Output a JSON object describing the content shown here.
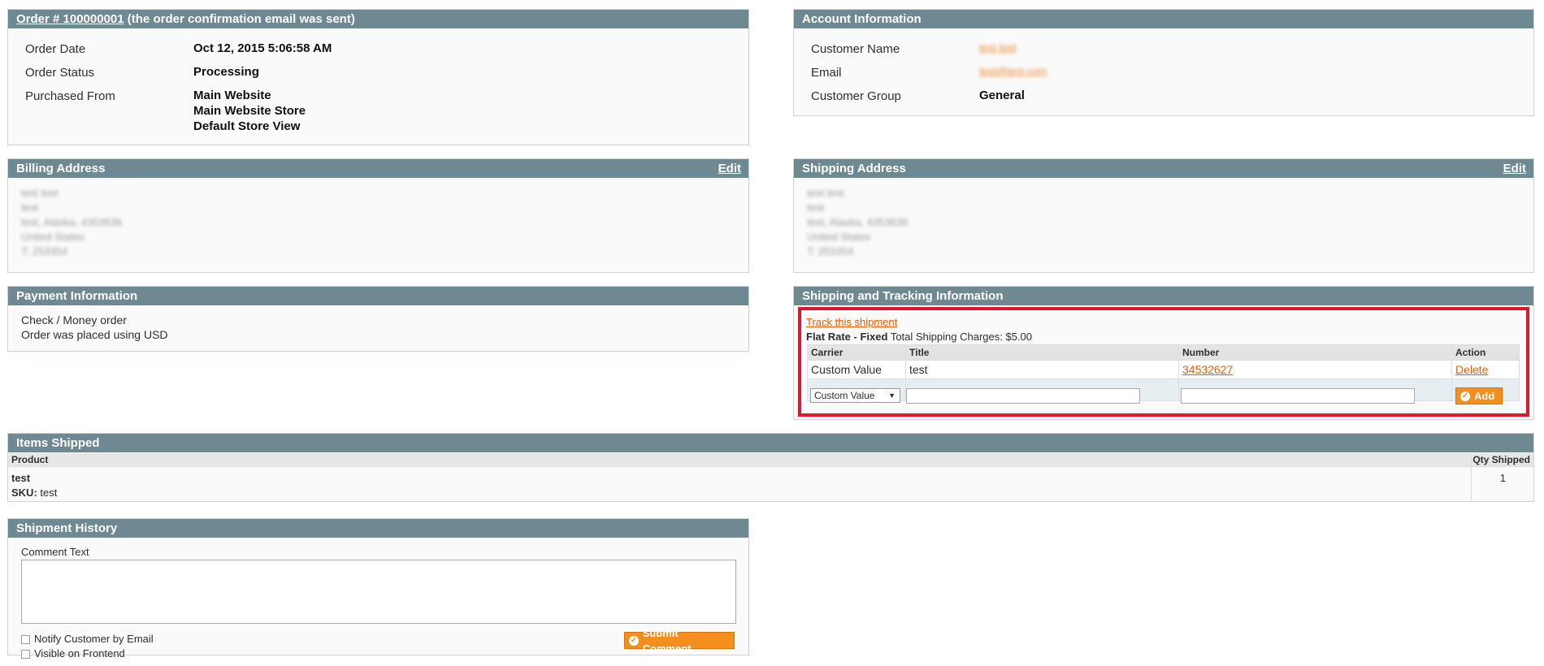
{
  "order": {
    "link": "Order # 100000001",
    "note": "(the order confirmation email was sent)",
    "date_label": "Order Date",
    "date_value": "Oct 12, 2015 5:06:58 AM",
    "status_label": "Order Status",
    "status_value": "Processing",
    "purchased_label": "Purchased From",
    "purchased_lines": [
      "Main Website",
      "Main Website Store",
      "Default Store View"
    ]
  },
  "account": {
    "title": "Account Information",
    "name_label": "Customer Name",
    "name_value": "test test",
    "email_label": "Email",
    "email_value": "test@test.com",
    "group_label": "Customer Group",
    "group_value": "General"
  },
  "billing": {
    "title": "Billing Address",
    "edit": "Edit",
    "lines": [
      "test test",
      "test",
      "test, Alaska, 4353636",
      "United States",
      "T: 253354"
    ]
  },
  "shipping_address": {
    "title": "Shipping Address",
    "edit": "Edit",
    "lines": [
      "test test",
      "test",
      "test, Alaska, 4353636",
      "United States",
      "T: 253354"
    ]
  },
  "payment": {
    "title": "Payment Information",
    "lines": [
      "Check / Money order",
      "Order was placed using USD"
    ]
  },
  "tracking": {
    "title": "Shipping and Tracking Information",
    "track_link": "Track this shipment",
    "method_bold": "Flat Rate - Fixed",
    "charges": "Total Shipping Charges: $5.00",
    "headers": [
      "Carrier",
      "Title",
      "Number",
      "Action"
    ],
    "row": {
      "carrier": "Custom Value",
      "title": "test",
      "number": "34532627",
      "action": "Delete"
    },
    "carrier_select": "Custom Value",
    "add_label": "Add"
  },
  "items": {
    "title": "Items Shipped",
    "col_product": "Product",
    "col_qty": "Qty Shipped",
    "product_name": "test",
    "sku_label": "SKU:",
    "sku_value": "test",
    "qty": "1"
  },
  "history": {
    "title": "Shipment History",
    "comment_label": "Comment Text",
    "notify_label": "Notify Customer by Email",
    "visible_label": "Visible on Frontend",
    "submit_label": "Submit Comment"
  },
  "colors": {
    "header": "#6f8992",
    "accent": "#f48e1d",
    "link": "#eb5e00",
    "highlight": "#e0172a"
  }
}
